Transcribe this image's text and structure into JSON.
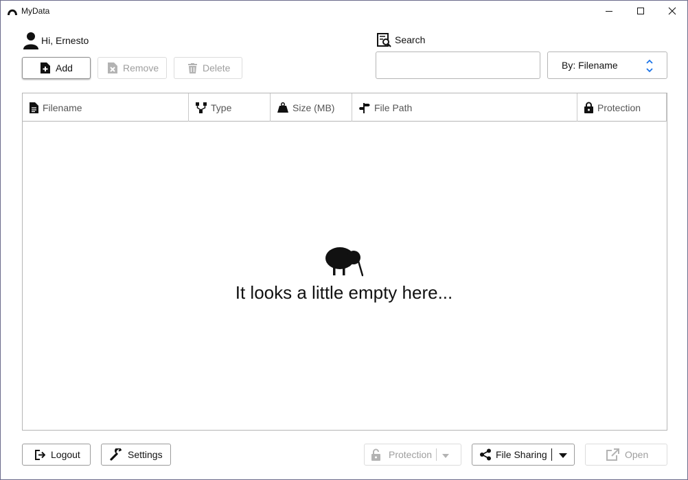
{
  "window": {
    "title": "MyData"
  },
  "user": {
    "greeting": "Hi, Ernesto"
  },
  "toolbar": {
    "add": "Add",
    "remove": "Remove",
    "delete": "Delete"
  },
  "search": {
    "label": "Search",
    "value": "",
    "by": "By: Filename"
  },
  "table": {
    "columns": [
      "Filename",
      "Type",
      "Size (MB)",
      "File Path",
      "Protection"
    ],
    "rows": [],
    "empty_message": "It looks a little empty here..."
  },
  "footer": {
    "logout": "Logout",
    "settings": "Settings",
    "protection": "Protection",
    "file_sharing": "File Sharing",
    "open": "Open"
  },
  "colors": {
    "accent": "#1a73e8",
    "disabled": "#9e9e9e",
    "border": "#b5b5b5"
  }
}
